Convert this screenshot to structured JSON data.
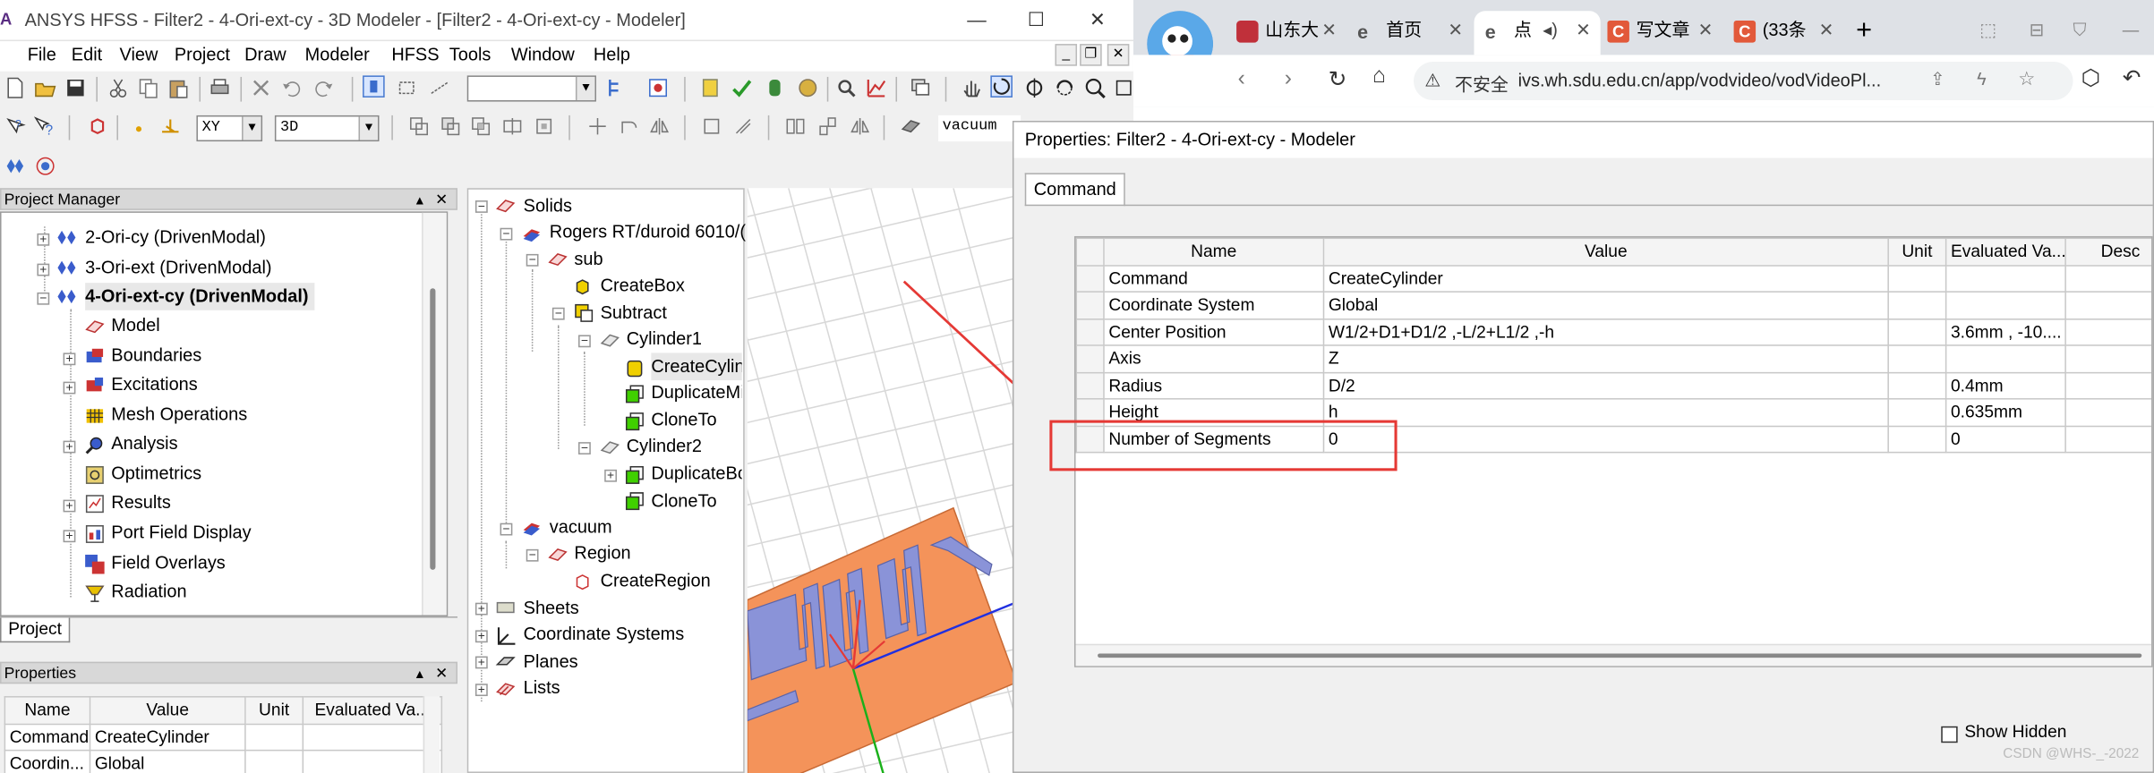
{
  "app": {
    "title": "ANSYS HFSS - Filter2 - 4-Ori-ext-cy - 3D Modeler - [Filter2 - 4-Ori-ext-cy - Modeler]",
    "logo": "A",
    "min": "—",
    "max": "☐",
    "close": "✕",
    "menu": [
      "File",
      "Edit",
      "View",
      "Project",
      "Draw",
      "Modeler",
      "HFSS",
      "Tools",
      "Window",
      "Help"
    ],
    "plane_combo": "XY",
    "view_combo": "3D",
    "material_combo": "vacuum"
  },
  "project_manager": {
    "header": "Project Manager",
    "tab": "Project",
    "items": [
      {
        "label": "2-Ori-cy (DrivenModal)",
        "bold": false
      },
      {
        "label": "3-Ori-ext (DrivenModal)",
        "bold": false
      },
      {
        "label": "4-Ori-ext-cy (DrivenModal)",
        "bold": true
      },
      {
        "label": "Model"
      },
      {
        "label": "Boundaries"
      },
      {
        "label": "Excitations"
      },
      {
        "label": "Mesh Operations"
      },
      {
        "label": "Analysis"
      },
      {
        "label": "Optimetrics"
      },
      {
        "label": "Results"
      },
      {
        "label": "Port Field Display"
      },
      {
        "label": "Field Overlays"
      },
      {
        "label": "Radiation"
      }
    ]
  },
  "properties_panel": {
    "header": "Properties",
    "columns": [
      "Name",
      "Value",
      "Unit",
      "Evaluated Va..."
    ],
    "rows": [
      [
        "Command",
        "CreateCylinder",
        "",
        ""
      ],
      [
        "Coordin...",
        "Global",
        "",
        ""
      ]
    ]
  },
  "model_tree": {
    "items": [
      "Solids",
      "Rogers RT/duroid 6010/(",
      "sub",
      "CreateBox",
      "Subtract",
      "Cylinder1",
      "CreateCylinc",
      "DuplicateMi",
      "CloneTo",
      "Cylinder2",
      "DuplicateBc",
      "CloneTo",
      "vacuum",
      "Region",
      "CreateRegion",
      "Sheets",
      "Coordinate Systems",
      "Planes",
      "Lists"
    ]
  },
  "browser": {
    "tabs": [
      {
        "label": "山东大"
      },
      {
        "label": "首页"
      },
      {
        "label": "点"
      },
      {
        "label": "写文章"
      },
      {
        "label": "(33条"
      }
    ],
    "new_tab": "+",
    "insecure_label": "不安全",
    "url": "ivs.wh.sdu.edu.cn/app/vodvideo/vodVideoPl..."
  },
  "dialog": {
    "title": "Properties: Filter2 - 4-Ori-ext-cy - Modeler",
    "tab": "Command",
    "columns": [
      "Name",
      "Value",
      "Unit",
      "Evaluated Va...",
      "Desc"
    ],
    "rows": [
      [
        "Command",
        "CreateCylinder",
        "",
        ""
      ],
      [
        "Coordinate System",
        "Global",
        "",
        ""
      ],
      [
        "Center Position",
        "W1/2+D1+D1/2 ,-L/2+L1/2 ,-h",
        "",
        "3.6mm , -10...."
      ],
      [
        "Axis",
        "Z",
        "",
        ""
      ],
      [
        "Radius",
        "D/2",
        "",
        "0.4mm"
      ],
      [
        "Height",
        "h",
        "",
        "0.635mm"
      ],
      [
        "Number of Segments",
        "0",
        "",
        "0"
      ]
    ],
    "show_hidden": "Show Hidden"
  },
  "watermark": "CSDN @WHS-_-2022",
  "colors": {
    "highlight_red": "#e53935",
    "substrate_orange": "#f4935a",
    "strip_blue": "#8a93d8"
  }
}
